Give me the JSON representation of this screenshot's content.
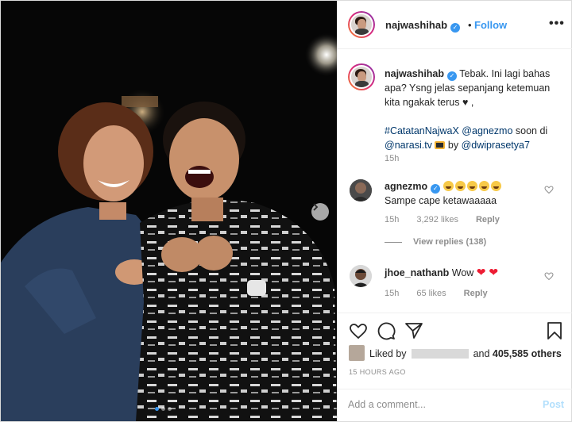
{
  "post": {
    "username": "najwashihab",
    "verified": true,
    "follow_label": "Follow",
    "separator": "•",
    "more_label": "•••"
  },
  "caption": {
    "username": "najwashihab",
    "text": "Tebak. Ini lagi bahas apa? Ysng jelas sepanjang ketemuan kita ngakak terus",
    "heart": "♥",
    "after_heart": " ,",
    "hashtag": "#CatatanNajwaX",
    "mention1": "@agnezmo",
    "mid_text": " soon di ",
    "mention2": "@narasi.tv",
    "tv_icon": "tv-emoji",
    "by_text": " by ",
    "mention3": "@dwiprasetya7",
    "time": "15h"
  },
  "comments": [
    {
      "username": "agnezmo",
      "verified": true,
      "emoji": [
        "joy-emoji",
        "joy-emoji",
        "joy-emoji",
        "joy-emoji",
        "joy-emoji"
      ],
      "text": "Sampe cape ketawaaaaa",
      "time": "15h",
      "likes": "3,292 likes",
      "reply_label": "Reply",
      "view_replies": "View replies (138)"
    },
    {
      "username": "jhoe_nathanb",
      "text": "Wow",
      "hearts": "❤ ❤",
      "time": "15h",
      "likes": "65 likes",
      "reply_label": "Reply"
    }
  ],
  "actions": {
    "liked_by_prefix": "Liked by",
    "liked_by_and": "and",
    "others": "405,585 others",
    "post_time": "15 HOURS AGO"
  },
  "comment_box": {
    "placeholder": "Add a comment...",
    "post_label": "Post"
  },
  "carousel": {
    "slides": 3,
    "active": 1
  },
  "colors": {
    "accent": "#3897f0",
    "link": "#00376b",
    "muted": "#8e8e8e",
    "heart_red": "#ed1c33"
  }
}
